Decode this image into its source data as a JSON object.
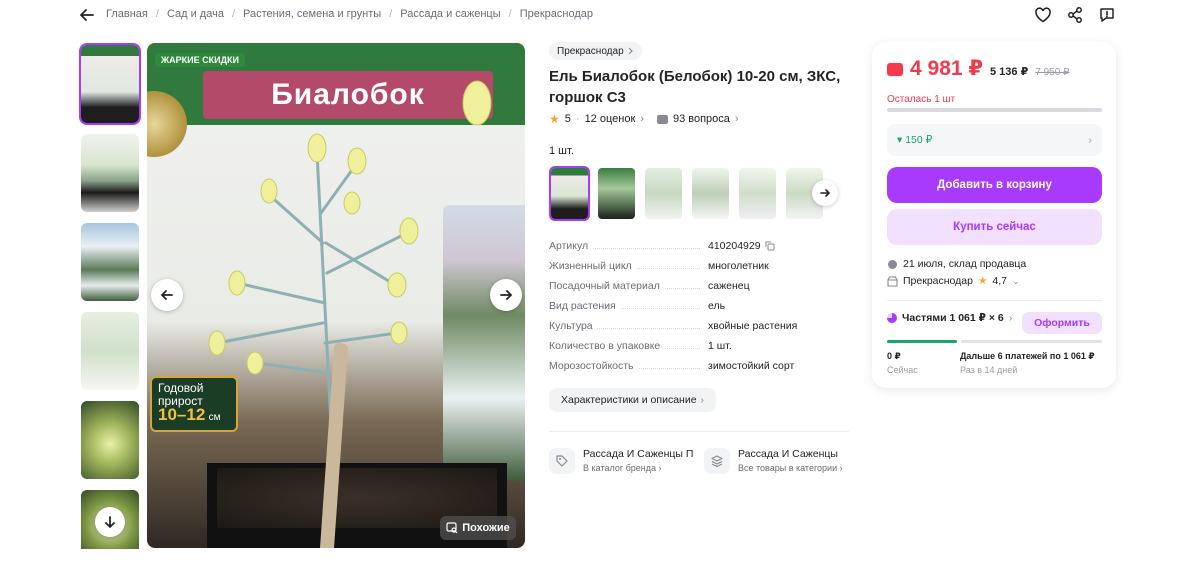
{
  "breadcrumbs": [
    "Главная",
    "Сад и дача",
    "Растения, семена и грунты",
    "Рассада и саженцы",
    "Прекраснодар"
  ],
  "gallery": {
    "banner_label": "ЖАРКИЕ СКИДКИ",
    "banner_title": "Биалобок",
    "growth_line1": "Годовой",
    "growth_line2": "прирост",
    "growth_value": "10–12",
    "growth_unit": "см",
    "similar_label": "Похожие"
  },
  "product": {
    "brand": "Прекраснодар",
    "title": "Ель Биалобок (Белобок) 10-20 см, ЗКС, горшок С3",
    "rating": "5",
    "reviews": "12 оценок",
    "questions": "93 вопроса",
    "quantity_label": "1 шт."
  },
  "specs": [
    {
      "k": "Артикул",
      "v": "410204929"
    },
    {
      "k": "Жизненный цикл",
      "v": "многолетник"
    },
    {
      "k": "Посадочный материал",
      "v": "саженец"
    },
    {
      "k": "Вид растения",
      "v": "ель"
    },
    {
      "k": "Культура",
      "v": "хвойные растения"
    },
    {
      "k": "Количество в упаковке",
      "v": "1 шт."
    },
    {
      "k": "Морозостойкость",
      "v": "зимостойкий сорт"
    }
  ],
  "specs_button": "Характеристики и описание",
  "stores": [
    {
      "title": "Рассада И Саженцы ПР",
      "sub": "В каталог бренда"
    },
    {
      "title": "Рассада И Саженцы",
      "sub": "Все товары в категории"
    }
  ],
  "buy": {
    "price": "4 981 ₽",
    "price_card": "5 136 ₽",
    "price_old": "7 950 ₽",
    "stock_left": "Осталась 1 шт",
    "bonus": "▾ 150 ₽",
    "add_to_cart": "Добавить в корзину",
    "buy_now": "Купить сейчас",
    "delivery_date": "21 июля, склад продавца",
    "seller": "Прекраснодар",
    "seller_rating": "4,7",
    "installments": "Частями 1 061 ₽ × 6",
    "installments_button": "Оформить",
    "pay_now_amount": "0 ₽",
    "pay_now_label": "Сейчас",
    "pay_later_amount": "Дальше 6 платежей по 1 061 ₽",
    "pay_later_label": "Раз в 14 дней"
  },
  "colors": {
    "accent": "#a73afd",
    "price": "#f33a4c",
    "green": "#1ba56a"
  }
}
